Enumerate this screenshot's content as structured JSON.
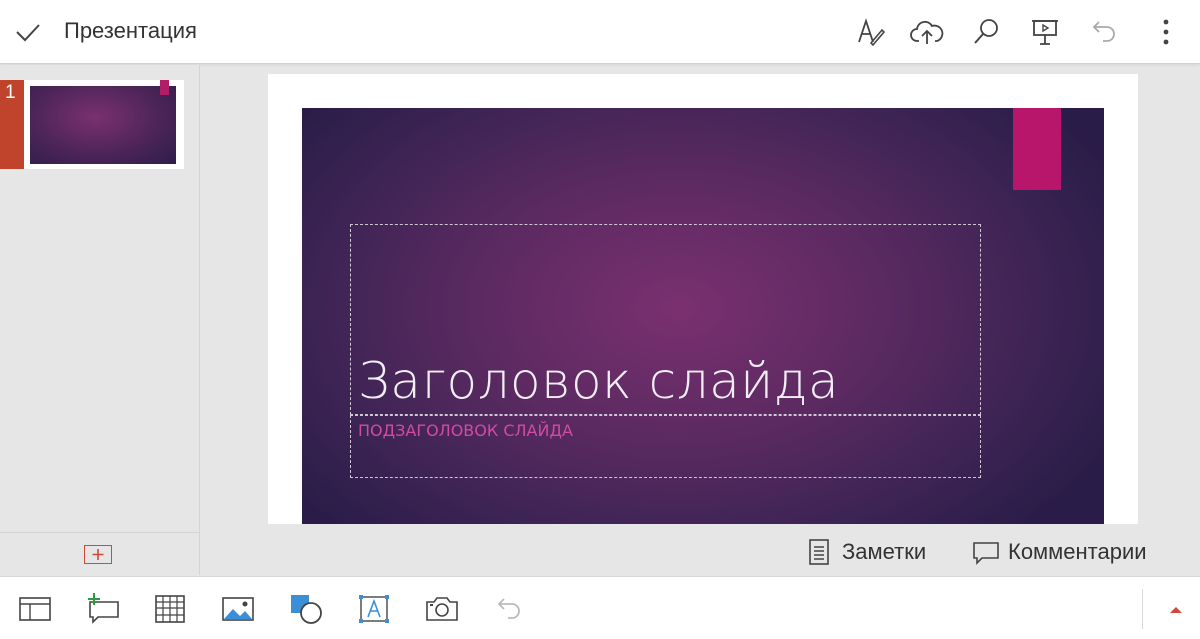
{
  "app": {
    "title": "Презентация"
  },
  "toolbar": {
    "icons": [
      "check-icon",
      "pen-text-icon",
      "cloud-upload-icon",
      "search-icon",
      "present-icon",
      "undo-icon",
      "more-icon"
    ]
  },
  "slides_panel": {
    "slides": [
      {
        "number": "1"
      }
    ]
  },
  "slide": {
    "title": "Заголовок слайда",
    "subtitle": "ПОДЗАГОЛОВОК СЛАЙДА"
  },
  "notes_bar": {
    "notes_label": "Заметки",
    "comments_label": "Комментарии"
  },
  "bottom_toolbar": {
    "icons": [
      "layout-icon",
      "new-comment-icon",
      "table-icon",
      "picture-icon",
      "shapes-icon",
      "textbox-icon",
      "camera-icon",
      "undo-icon",
      "expand-up-icon"
    ]
  },
  "colors": {
    "accent": "#c0442b",
    "slide_tag": "#b8166a",
    "subtitle": "#d14ba4"
  }
}
